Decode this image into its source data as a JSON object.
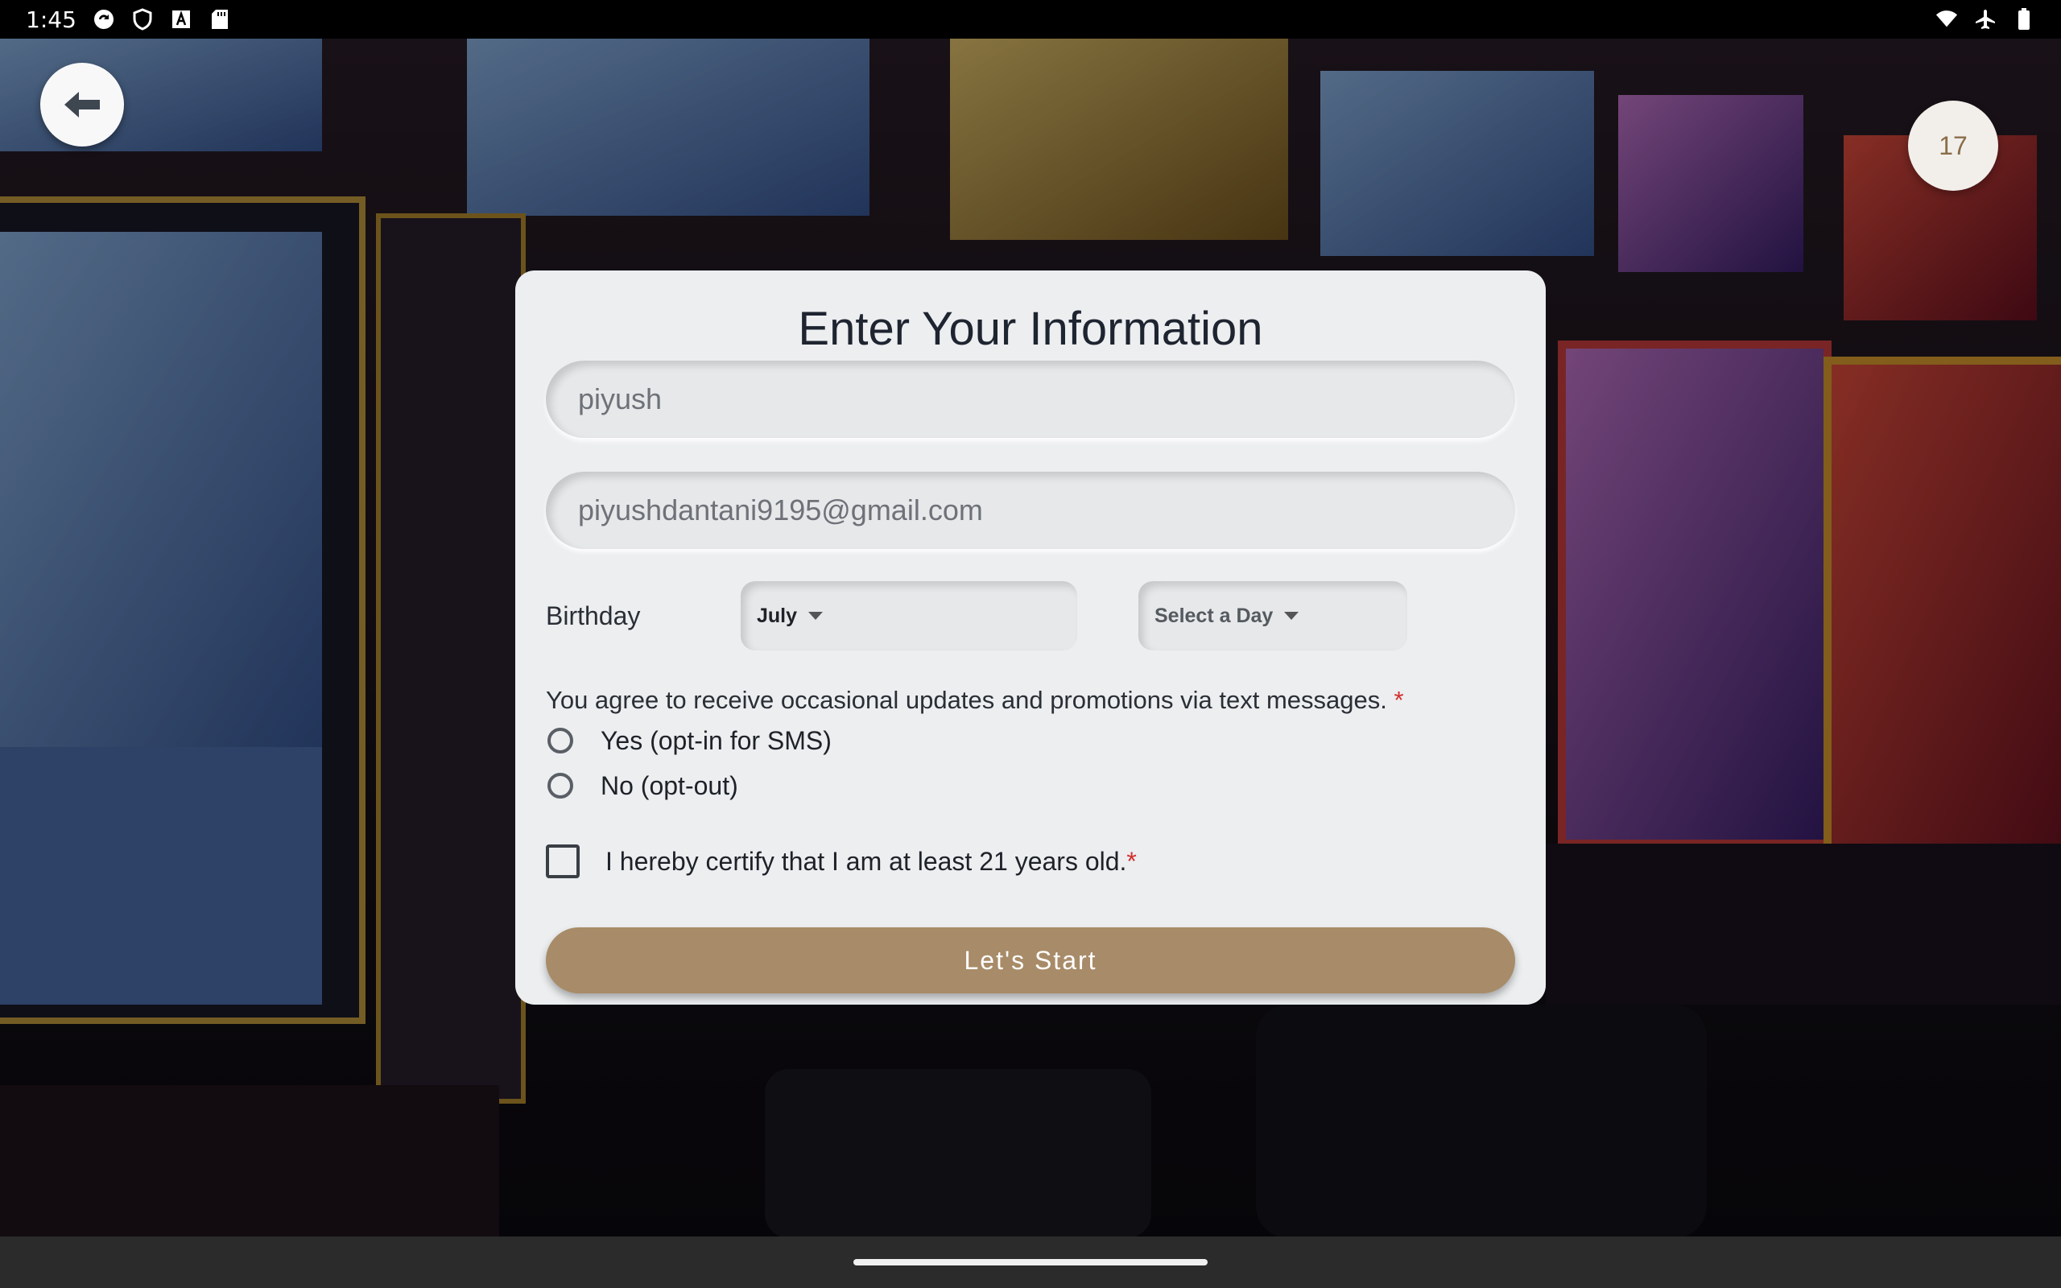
{
  "status_bar": {
    "time": "1:45",
    "left_icons": [
      "sync-icon",
      "shield-icon",
      "font-icon",
      "sd-card-icon"
    ],
    "right_icons": [
      "wifi-icon",
      "airplane-icon",
      "battery-icon"
    ]
  },
  "background": {
    "description_icon": "casino-slot-machines-image"
  },
  "header": {
    "back_icon": "arrow-left-icon",
    "counter": "17"
  },
  "form": {
    "title": "Enter Your Information",
    "name_value": "piyush",
    "email_value": "piyushdantani9195@gmail.com",
    "birthday_label": "Birthday",
    "month_selected": "July",
    "day_selected": "Select a Day",
    "sms_question": "You agree to receive occasional updates and promotions via text messages.",
    "required_mark": "*",
    "sms_yes": "Yes (opt-in for SMS)",
    "sms_no": "No (opt-out)",
    "certify_text": "I hereby certify that I am at least 21 years old.",
    "submit_label": "Let's Start"
  },
  "colors": {
    "accent": "#a88b68",
    "card": "#eceef0",
    "required": "#d32f2f",
    "counter_text": "#8a6d4a"
  }
}
